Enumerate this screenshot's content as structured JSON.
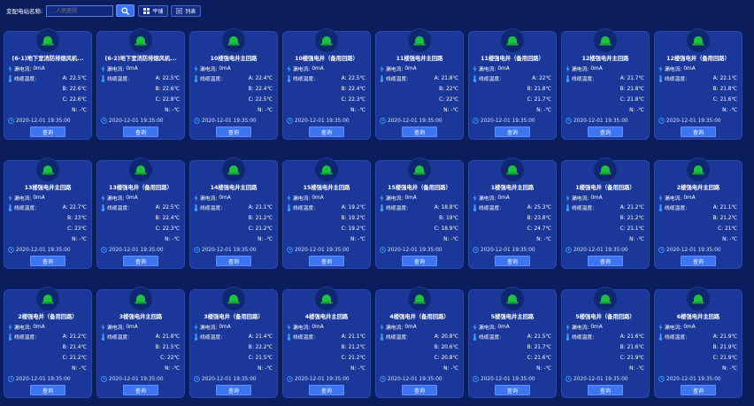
{
  "toolbar": {
    "site_label": "变配电站名称:",
    "site_value": "",
    "site_placeholder": "…人民医院",
    "tile_label": "平铺",
    "list_label": "列表"
  },
  "colors": {
    "background": "#0c1d5e",
    "card": "#1a3799",
    "accent_button": "#3d74ef",
    "status_ok": "#1fbf43",
    "bolt": "#3aa0ff"
  },
  "labels": {
    "leak": "漏电流:",
    "temp": "线缆温度:",
    "phase_b": "B:",
    "phase_c": "C:",
    "phase_n": "N:",
    "query": "查询"
  },
  "icons": {
    "status": "green-dome-status-icon",
    "leak": "lightning-bolt-icon",
    "temp": "thermometer-icon",
    "time": "clock-icon",
    "search": "search-icon"
  },
  "cards": [
    {
      "title": "(6-1)地下室消防排烟风机...",
      "leak": "0mA",
      "a": "22.5℃",
      "b": "22.6℃",
      "c": "22.6℃",
      "n": "-℃",
      "time": "2020-12-01 19:35:00"
    },
    {
      "title": "(6-2)地下室消防排烟风机...",
      "leak": "0mA",
      "a": "22.5℃",
      "b": "22.6℃",
      "c": "22.8℃",
      "n": "-℃",
      "time": "2020-12-01 19:35:00"
    },
    {
      "title": "10楼强电井主回路",
      "leak": "0mA",
      "a": "22.4℃",
      "b": "22.4℃",
      "c": "22.5℃",
      "n": "-℃",
      "time": "2020-12-01 19:35:00"
    },
    {
      "title": "10楼强电井（备用回路）",
      "leak": "0mA",
      "a": "22.5℃",
      "b": "22.4℃",
      "c": "22.3℃",
      "n": "-℃",
      "time": "2020-12-01 19:35:00"
    },
    {
      "title": "11楼强电井主回路",
      "leak": "0mA",
      "a": "21.8℃",
      "b": "22℃",
      "c": "22℃",
      "n": "-℃",
      "time": "2020-12-01 19:35:00"
    },
    {
      "title": "11楼强电井（备用回路）",
      "leak": "0mA",
      "a": "22℃",
      "b": "21.8℃",
      "c": "21.7℃",
      "n": "-℃",
      "time": "2020-12-01 19:35:00"
    },
    {
      "title": "12楼强电井主回路",
      "leak": "0mA",
      "a": "21.7℃",
      "b": "21.8℃",
      "c": "21.8℃",
      "n": "-℃",
      "time": "2020-12-01 19:35:00"
    },
    {
      "title": "12楼强电井（备用回路）",
      "leak": "0mA",
      "a": "22.1℃",
      "b": "21.8℃",
      "c": "21.6℃",
      "n": "-℃",
      "time": "2020-12-01 19:35:00"
    },
    {
      "title": "13楼强电井主回路",
      "leak": "0mA",
      "a": "22.7℃",
      "b": "23℃",
      "c": "23℃",
      "n": "-℃",
      "time": "2020-12-01 19:35:00"
    },
    {
      "title": "13楼强电井（备用回路）",
      "leak": "0mA",
      "a": "22.5℃",
      "b": "22.4℃",
      "c": "22.3℃",
      "n": "-℃",
      "time": "2020-12-01 19:35:00"
    },
    {
      "title": "14楼强电井主回路",
      "leak": "0mA",
      "a": "21.1℃",
      "b": "21.2℃",
      "c": "21.2℃",
      "n": "-℃",
      "time": "2020-12-01 19:35:00"
    },
    {
      "title": "15楼强电井主回路",
      "leak": "0mA",
      "a": "19.2℃",
      "b": "19.2℃",
      "c": "19.2℃",
      "n": "-℃",
      "time": "2020-12-01 19:35:00"
    },
    {
      "title": "15楼强电井（备用回路）",
      "leak": "0mA",
      "a": "18.8℃",
      "b": "19℃",
      "c": "18.9℃",
      "n": "-℃",
      "time": "2020-12-01 19:35:00"
    },
    {
      "title": "1楼强电井主回路",
      "leak": "0mA",
      "a": "25.3℃",
      "b": "23.8℃",
      "c": "24.7℃",
      "n": "-℃",
      "time": "2020-12-01 19:35:00"
    },
    {
      "title": "1楼强电井（备用回路）",
      "leak": "0mA",
      "a": "21.2℃",
      "b": "21.2℃",
      "c": "21.1℃",
      "n": "-℃",
      "time": "2020-12-01 19:35:00"
    },
    {
      "title": "2楼强电井主回路",
      "leak": "0mA",
      "a": "21.1℃",
      "b": "21.2℃",
      "c": "21℃",
      "n": "-℃",
      "time": "2020-12-01 19:35:00"
    },
    {
      "title": "2楼强电井（备用回路）",
      "leak": "0mA",
      "a": "21.2℃",
      "b": "21.4℃",
      "c": "21.2℃",
      "n": "-℃",
      "time": "2020-12-01 19:35:00"
    },
    {
      "title": "3楼强电井主回路",
      "leak": "0mA",
      "a": "21.8℃",
      "b": "21.5℃",
      "c": "22℃",
      "n": "-℃",
      "time": "2020-12-01 19:35:00"
    },
    {
      "title": "3楼强电井（备用回路）",
      "leak": "0mA",
      "a": "21.4℃",
      "b": "22.2℃",
      "c": "21.5℃",
      "n": "-℃",
      "time": "2020-12-01 19:35:00"
    },
    {
      "title": "4楼强电井主回路",
      "leak": "0mA",
      "a": "21.1℃",
      "b": "21.2℃",
      "c": "21.2℃",
      "n": "-℃",
      "time": "2020-12-01 19:35:00"
    },
    {
      "title": "4楼强电井（备用回路）",
      "leak": "0mA",
      "a": "20.8℃",
      "b": "20.6℃",
      "c": "20.8℃",
      "n": "-℃",
      "time": "2020-12-01 19:35:00"
    },
    {
      "title": "5楼强电井主回路",
      "leak": "0mA",
      "a": "21.5℃",
      "b": "21.7℃",
      "c": "21.6℃",
      "n": "-℃",
      "time": "2020-12-01 19:35:00"
    },
    {
      "title": "5楼强电井（备用回路）",
      "leak": "0mA",
      "a": "21.6℃",
      "b": "21.6℃",
      "c": "21.9℃",
      "n": "-℃",
      "time": "2020-12-01 19:35:00"
    },
    {
      "title": "6楼强电井主回路",
      "leak": "0mA",
      "a": "21.9℃",
      "b": "21.9℃",
      "c": "21.9℃",
      "n": "-℃",
      "time": "2020-12-01 19:35:00"
    }
  ]
}
